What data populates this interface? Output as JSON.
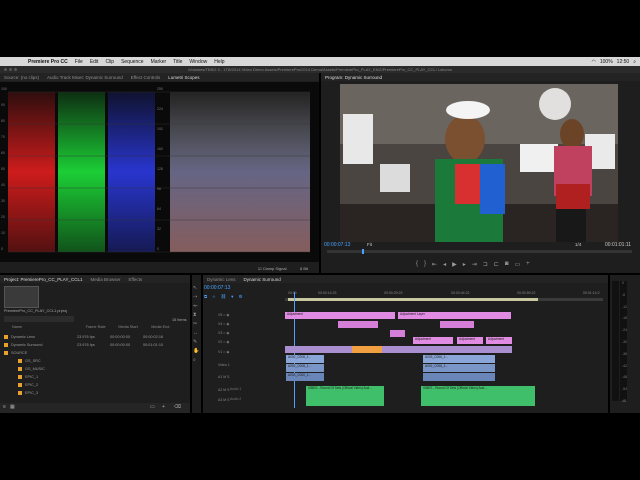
{
  "menubar": {
    "app_name": "Premiere Pro CC",
    "items": [
      "File",
      "Edit",
      "Clip",
      "Sequence",
      "Marker",
      "Title",
      "Window",
      "Help"
    ],
    "status_battery": "100%",
    "status_time": "12:50"
  },
  "window": {
    "title": "/Volumes/TBSO 3 - 1TB/2014 Video Demo Assets/PremierePro/2014 Demo/Assets/PremierePro_PLAY_ENG/PremierePro_CC_PLAY_CCL/ Lokomo"
  },
  "source_panel": {
    "tabs": [
      "Source: (no clips)",
      "Audio Track Mixer: Dynamic Surround",
      "Effect Controls",
      "Lumetri Scopes"
    ],
    "active_tab": "Lumetri Scopes",
    "scale_left": [
      "100",
      "90",
      "80",
      "70",
      "60",
      "50",
      "40",
      "30",
      "20",
      "10",
      "0"
    ],
    "scale_right": [
      "255",
      "224",
      "192",
      "160",
      "128",
      "96",
      "64",
      "32",
      "0"
    ],
    "clamp_label": "Clamp Signal",
    "bit_label": "8 Bit"
  },
  "program_panel": {
    "title": "Program: Dynamic Surround",
    "timecode": "00:00:07:13",
    "fit": "Fit",
    "quality": "1/4",
    "duration": "00:01:01:11",
    "cap_text": "RA"
  },
  "project_panel": {
    "tabs": [
      "Project: PremierePro_CC_PLAY_CCL1",
      "Media Browser",
      "Effects"
    ],
    "project_file": "PremierePro_CC_PLAY_CCL1.prproj",
    "items_count": "15 Items",
    "columns": [
      "Name",
      "Frame Rate",
      "Media Start",
      "Media End"
    ],
    "rows": [
      {
        "name": "Dynamic Lens",
        "frame_rate": "23.976 fps",
        "start": "00:00:00:00",
        "end": "00:00:02:16",
        "color": "#e8a030"
      },
      {
        "name": "Dynamic Surround",
        "frame_rate": "23.976 fps",
        "start": "00:00:00:00",
        "end": "00:01:01:10",
        "color": "#e8a030"
      },
      {
        "name": "SOURCE",
        "frame_rate": "",
        "start": "",
        "end": "",
        "color": "#e8a030"
      },
      {
        "name": "GS_SRC",
        "frame_rate": "",
        "start": "",
        "end": "",
        "color": "#e8a030"
      },
      {
        "name": "GS_MUSIC",
        "frame_rate": "",
        "start": "",
        "end": "",
        "color": "#e8a030"
      },
      {
        "name": "EPIC_1",
        "frame_rate": "",
        "start": "",
        "end": "",
        "color": "#e8a030"
      },
      {
        "name": "EPIC_2",
        "frame_rate": "",
        "start": "",
        "end": "",
        "color": "#e8a030"
      },
      {
        "name": "EPIC_3",
        "frame_rate": "",
        "start": "",
        "end": "",
        "color": "#e8a030"
      }
    ]
  },
  "timeline": {
    "tabs": [
      "Dynamic Lens",
      "Dynamic Surround"
    ],
    "active_tab": "Dynamic Surround",
    "timecode": "00:00:07:13",
    "ruler": [
      "00:00",
      "00:00:14:23",
      "00:00:29:23",
      "00:00:44:22",
      "00:00:59:22",
      "00:01:14:2"
    ],
    "video_tracks": [
      "V5",
      "V4",
      "V3",
      "V2",
      "V1"
    ],
    "audio_tracks": [
      "A1",
      "A2",
      "A3"
    ],
    "track_labels": [
      "Video 1",
      "Audio 1",
      "Audio 2"
    ],
    "clips": {
      "adjustment_1": "Adjustment",
      "adjustment_2": "Adjustment Layer",
      "adjustment_3": "Adjustment",
      "adjustment_4": "Adjustment",
      "adjustment_5": "Adjustment",
      "video_clip_1": "A002_C008_1...",
      "video_clip_2": "A003_C066_1...",
      "video_clip_3": "A002_C008_1...",
      "video_clip_4": "A002_C058_1...",
      "video_clip_5": "A003_C060_1...",
      "audio_clip_1": "VIBES - Round Of Sets (Official Video) Aud...",
      "audio_clip_2": "VIBES - Round Of Sets (Official Video) Aud..."
    },
    "vu_labels": [
      "0",
      "-6",
      "-12",
      "-18",
      "-24",
      "-30",
      "-36",
      "-42",
      "-48",
      "-54",
      "dB"
    ]
  }
}
